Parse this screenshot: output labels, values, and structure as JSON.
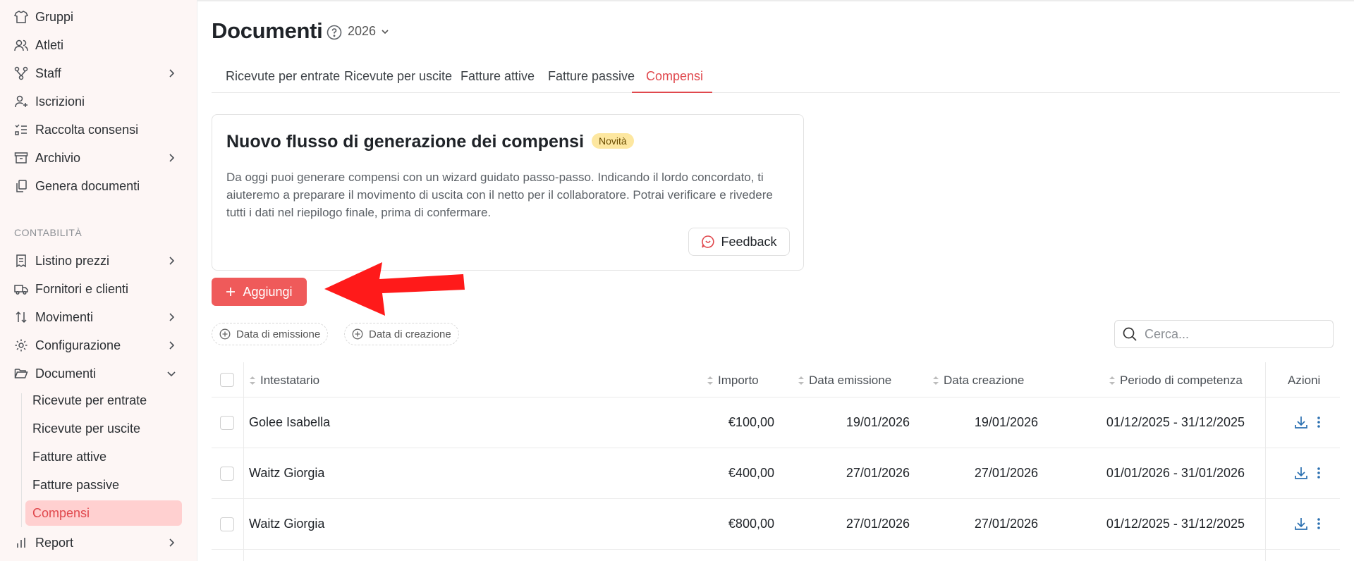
{
  "sidebar": {
    "items": [
      {
        "label": "Gruppi",
        "icon": "shirt-icon"
      },
      {
        "label": "Atleti",
        "icon": "users-icon"
      },
      {
        "label": "Staff",
        "icon": "org-icon"
      },
      {
        "label": "Iscrizioni",
        "icon": "user-plus-icon"
      },
      {
        "label": "Raccolta consensi",
        "icon": "list-check-icon"
      },
      {
        "label": "Archivio",
        "icon": "archive-icon"
      },
      {
        "label": "Genera documenti",
        "icon": "copy-doc-icon"
      }
    ],
    "section_label": "CONTABILITÀ",
    "acc_items": [
      {
        "label": "Listino prezzi",
        "icon": "receipt-icon"
      },
      {
        "label": "Fornitori e clienti",
        "icon": "truck-icon"
      },
      {
        "label": "Movimenti",
        "icon": "arrows-updown-icon"
      },
      {
        "label": "Configurazione",
        "icon": "gear-icon"
      },
      {
        "label": "Documenti",
        "icon": "folder-open-icon"
      }
    ],
    "sub_items": [
      "Ricevute per entrate",
      "Ricevute per uscite",
      "Fatture attive",
      "Fatture passive",
      "Compensi"
    ],
    "report": {
      "label": "Report",
      "icon": "bar-chart-icon"
    }
  },
  "page": {
    "title": "Documenti",
    "year": "2026"
  },
  "tabs": [
    "Ricevute per entrate",
    "Ricevute per uscite",
    "Fatture attive",
    "Fatture passive",
    "Compensi"
  ],
  "card": {
    "title": "Nuovo flusso di generazione dei compensi",
    "badge": "Novità",
    "body": "Da oggi puoi generare compensi con un wizard guidato passo-passo. Indicando il lordo concordato, ti aiuteremo a preparare il movimento di uscita con il netto per il collaboratore. Potrai verificare e rivedere tutti i dati nel riepilogo finale, prima di confermare.",
    "feedback_label": "Feedback"
  },
  "add_button": "Aggiungi",
  "filters": [
    "Data di emissione",
    "Data di creazione"
  ],
  "search": {
    "placeholder": "Cerca..."
  },
  "table": {
    "columns": [
      "Intestatario",
      "Importo",
      "Data emissione",
      "Data creazione",
      "Periodo di competenza",
      "Azioni"
    ],
    "rows": [
      {
        "intestatario": "Golee Isabella",
        "importo": "€100,00",
        "emissione": "19/01/2026",
        "creazione": "19/01/2026",
        "periodo": "01/12/2025 - 31/12/2025"
      },
      {
        "intestatario": "Waitz Giorgia",
        "importo": "€400,00",
        "emissione": "27/01/2026",
        "creazione": "27/01/2026",
        "periodo": "01/01/2026 - 31/01/2026"
      },
      {
        "intestatario": "Waitz Giorgia",
        "importo": "€800,00",
        "emissione": "27/01/2026",
        "creazione": "27/01/2026",
        "periodo": "01/12/2025 - 31/12/2025"
      }
    ]
  },
  "colors": {
    "accent": "#e0484d",
    "button": "#ef5a5a",
    "active_bg": "#ffd0d0",
    "badge_bg": "#fde7a0",
    "arrow": "#ff1a1a",
    "action_icon": "#2a6fb0"
  }
}
